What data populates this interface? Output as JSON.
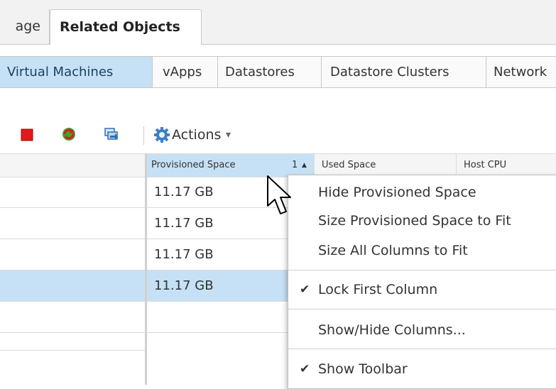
{
  "top_tabs": [
    {
      "label": "age",
      "active": false
    },
    {
      "label": "Related Objects",
      "active": true
    }
  ],
  "sub_tabs": [
    {
      "label": "Virtual Machines",
      "active": true
    },
    {
      "label": "vApps",
      "active": false
    },
    {
      "label": "Datastores",
      "active": false
    },
    {
      "label": "Datastore Clusters",
      "active": false
    },
    {
      "label": "Network",
      "active": false
    }
  ],
  "toolbar": {
    "icons": [
      "stop-icon",
      "refresh-icon",
      "migrate-icon",
      "actions-gear-icon"
    ],
    "actions_label": "Actions",
    "actions_caret": "▾"
  },
  "grid": {
    "columns": [
      {
        "label": "Provisioned Space",
        "sort_order": "1",
        "sort_dir": "▲",
        "sorted": true
      },
      {
        "label": "Used Space",
        "sorted": false
      },
      {
        "label": "Host CPU",
        "sorted": false
      }
    ],
    "rows": [
      {
        "provisioned": "11.17  GB",
        "selected": false
      },
      {
        "provisioned": "11.17  GB",
        "selected": false
      },
      {
        "provisioned": "11.17  GB",
        "selected": false
      },
      {
        "provisioned": "11.17  GB",
        "selected": true
      },
      {
        "provisioned": "",
        "selected": false
      },
      {
        "provisioned": "",
        "selected": false
      }
    ]
  },
  "context_menu": {
    "items": [
      {
        "label": "Hide Provisioned Space",
        "checked": false
      },
      {
        "label": "Size Provisioned Space to Fit",
        "checked": false
      },
      {
        "label": "Size All Columns to Fit",
        "checked": false
      },
      {
        "label": "Lock First Column",
        "checked": true
      },
      {
        "label": "Show/Hide Columns...",
        "checked": false
      },
      {
        "label": "Show Toolbar",
        "checked": true
      }
    ],
    "check_glyph": "✔"
  },
  "colors": {
    "selection": "#c6e1f5",
    "stop_red": "#e01a1a",
    "refresh_green": "#3aa52f",
    "gear_blue": "#3b7fc4"
  }
}
